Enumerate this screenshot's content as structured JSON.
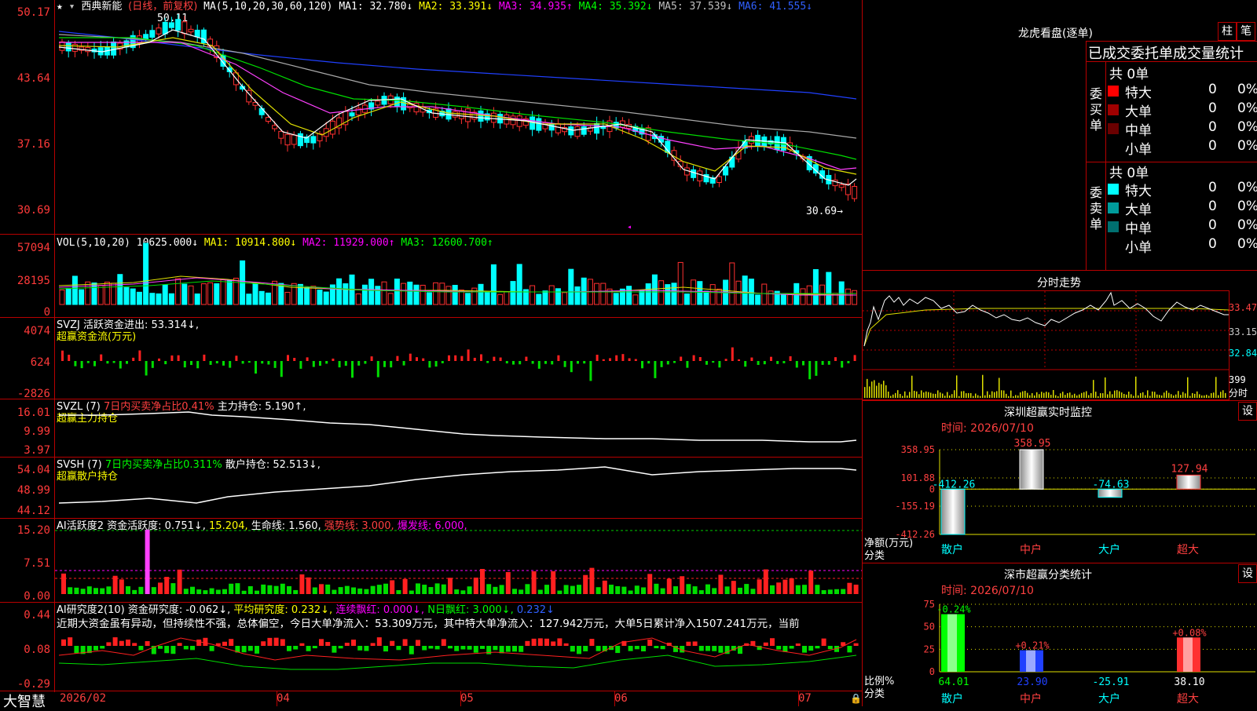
{
  "stock": {
    "name": "西典新能",
    "period": "(日线，前复权)"
  },
  "ma_line": {
    "label": "MA(5,10,20,30,60,120)",
    "ma1": "MA1: 32.780↓",
    "ma2": "MA2: 33.391↓",
    "ma3": "MA3: 34.935↑",
    "ma4": "MA4: 35.392↓",
    "ma5": "MA5: 37.539↓",
    "ma6": "MA6: 41.555↓"
  },
  "main_axis": [
    "50.17",
    "43.64",
    "37.16",
    "30.69"
  ],
  "main_marks": {
    "high": "50.11",
    "low": "30.69→"
  },
  "vol": {
    "label": "VOL(5,10,20)",
    "value": "10625.000↓",
    "ma1": "MA1: 10914.800↓",
    "ma2": "MA2: 11929.000↑",
    "ma3": "MA3: 12600.700↑",
    "axis": [
      "57094",
      "28195",
      "0"
    ]
  },
  "svzj": {
    "label": "SVZJ  活跃资金进出: 53.314↓,",
    "sub": "超赢资金流(万元)",
    "axis": [
      "4074",
      "624",
      "-2826"
    ]
  },
  "svzl": {
    "label": "SVZL (7)",
    "pct": "7日内买卖净占比0.41%",
    "hold": "主力持仓: 5.190↑,",
    "sub": "超赢主力持仓",
    "axis": [
      "16.01",
      "9.99",
      "3.97"
    ]
  },
  "svsh": {
    "label": "SVSH (7)",
    "pct": "7日内买卖净占比0.311%",
    "hold": "散户持仓: 52.513↓,",
    "sub": "超赢散户持仓",
    "axis": [
      "54.04",
      "48.99",
      "44.12"
    ]
  },
  "ai2": {
    "label": "AI活跃度2 资金活跃度: 0.751↓,",
    "v2": "15.204,",
    "life": "生命线: 1.560,",
    "strong": "强势线: 3.000,",
    "burst": "爆发线: 6.000,",
    "axis": [
      "15.20",
      "7.51",
      "0.00"
    ]
  },
  "ai_research": {
    "label": "AI研究度2(10) 资金研究度: -0.062↓,",
    "avg": "平均研究度: 0.232↓,",
    "lianxu": "连续飘红: 0.000↓,",
    "nday": "N日飘红: 3.000↓,",
    "v5": "0.232↓",
    "comment": "近期大资金虽有异动，但持续性不强，总体偏空，今日大单净流入：53.309万元，其中特大单净流入：127.942万元，大单5日累计净入1507.241万元，当前",
    "axis": [
      "0.44",
      "0.08",
      "-0.29"
    ]
  },
  "x_axis": [
    "2026/02",
    "04",
    "05",
    "06",
    "07"
  ],
  "brand": "大智慧",
  "dragon": {
    "title": "龙虎看盘(逐单)",
    "tab1": "柱",
    "tab2": "笔",
    "heading": "已成交委托单成交量统计",
    "buy_label": "委买单",
    "sell_label": "委卖单",
    "buy_total": "共 0单",
    "sell_total": "共 0单",
    "buy_rows": [
      {
        "name": "特大",
        "count": "0",
        "pct": "0%",
        "color": "#ff0000"
      },
      {
        "name": "大单",
        "count": "0",
        "pct": "0%",
        "color": "#a00000"
      },
      {
        "name": "中单",
        "count": "0",
        "pct": "0%",
        "color": "#6a0000"
      },
      {
        "name": "小单",
        "count": "0",
        "pct": "0%",
        "color": "#000000"
      }
    ],
    "sell_rows": [
      {
        "name": "特大",
        "count": "0",
        "pct": "0%",
        "color": "#00ffff"
      },
      {
        "name": "大单",
        "count": "0",
        "pct": "0%",
        "color": "#009c9c"
      },
      {
        "name": "中单",
        "count": "0",
        "pct": "0%",
        "color": "#007070"
      },
      {
        "name": "小单",
        "count": "0",
        "pct": "0%",
        "color": "#000000"
      }
    ]
  },
  "intraday": {
    "title": "分时走势",
    "axis": [
      "33.47",
      "33.15",
      "32.84"
    ],
    "vol": "399",
    "vol_label": "分时"
  },
  "sz_monitor": {
    "title": "深圳超赢实时监控",
    "settings": "设",
    "time": "时间: 2026/07/10",
    "axis": [
      "358.95",
      "101.88",
      "0",
      "-155.19",
      "-412.26"
    ],
    "ylabel1": "净额(万元)",
    "ylabel2": "分类",
    "bars": [
      {
        "cat": "散户",
        "value": -412.26,
        "label": "-412.26"
      },
      {
        "cat": "中户",
        "value": 358.95,
        "label": "358.95"
      },
      {
        "cat": "大户",
        "value": -74.63,
        "label": "-74.63"
      },
      {
        "cat": "超大",
        "value": 127.94,
        "label": "127.94"
      }
    ]
  },
  "sz_class": {
    "title": "深市超赢分类统计",
    "settings": "设",
    "time": "时间: 2026/07/10",
    "axis": [
      "75",
      "50",
      "25",
      "0"
    ],
    "ylabel1": "比例%",
    "ylabel2": "分类",
    "bars": [
      {
        "cat": "散户",
        "value": 64.01,
        "label": "64.01",
        "top": "-0.24%"
      },
      {
        "cat": "中户",
        "value": 23.9,
        "label": "23.90",
        "top": "+0.21%"
      },
      {
        "cat": "大户",
        "value": -25.91,
        "label": "-25.91",
        "top": ""
      },
      {
        "cat": "超大",
        "value": 38.1,
        "label": "38.10",
        "top": "+0.08%"
      }
    ]
  }
}
